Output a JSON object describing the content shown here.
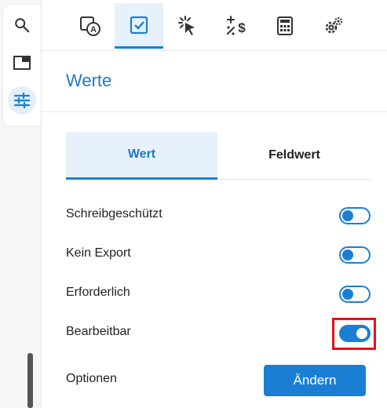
{
  "rail": {
    "items": [
      {
        "icon": "search-icon"
      },
      {
        "icon": "panel-icon"
      },
      {
        "icon": "sliders-icon",
        "active": true
      }
    ]
  },
  "toolbar": {
    "items": [
      {
        "icon": "text-field-icon"
      },
      {
        "icon": "checkbox-icon",
        "active": true
      },
      {
        "icon": "cursor-click-icon"
      },
      {
        "icon": "calculation-icon"
      },
      {
        "icon": "calculator-icon"
      },
      {
        "icon": "gears-icon"
      }
    ]
  },
  "section": {
    "title": "Werte"
  },
  "tabs": [
    {
      "label": "Wert",
      "active": true
    },
    {
      "label": "Feldwert",
      "active": false
    }
  ],
  "properties": [
    {
      "label": "Schreibgeschützt",
      "on": false
    },
    {
      "label": "Kein Export",
      "on": false
    },
    {
      "label": "Erforderlich",
      "on": false
    },
    {
      "label": "Bearbeitbar",
      "on": true
    }
  ],
  "options": {
    "label": "Optionen",
    "button_label": "Ändern"
  },
  "colors": {
    "accent": "#1a7fd4",
    "title": "#1f78c9",
    "highlight": "#e4121a"
  }
}
